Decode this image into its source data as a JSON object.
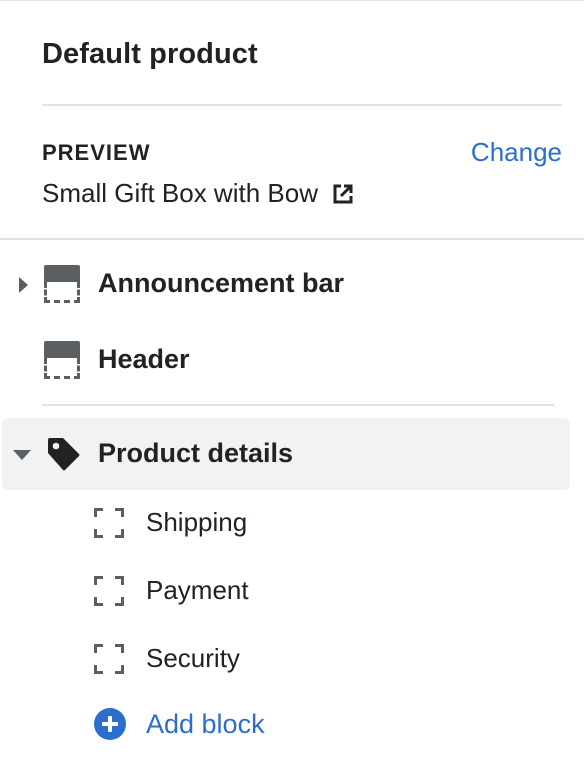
{
  "panel": {
    "title": "Default product"
  },
  "preview": {
    "label": "PREVIEW",
    "change_label": "Change",
    "product_name": "Small Gift Box with Bow",
    "external_icon": "external-link-icon"
  },
  "sections": [
    {
      "label": "Announcement bar",
      "icon": "section-layout-icon",
      "expander": "caret-right",
      "expanded": false,
      "selected": false
    },
    {
      "label": "Header",
      "icon": "section-layout-icon",
      "expanded": false,
      "selected": false
    },
    {
      "label": "Product details",
      "icon": "product-tag-icon",
      "expander": "caret-down",
      "expanded": true,
      "selected": true
    }
  ],
  "blocks": [
    {
      "label": "Shipping",
      "icon": "block-frame-icon"
    },
    {
      "label": "Payment",
      "icon": "block-frame-icon"
    },
    {
      "label": "Security",
      "icon": "block-frame-icon"
    }
  ],
  "add_block": {
    "label": "Add block",
    "icon": "plus-circle-icon"
  },
  "colors": {
    "accent": "#2c6ecb",
    "text": "#202223",
    "icon": "#5c5f62",
    "divider": "#e1e3e5",
    "selected_bg": "#f1f2f3"
  }
}
